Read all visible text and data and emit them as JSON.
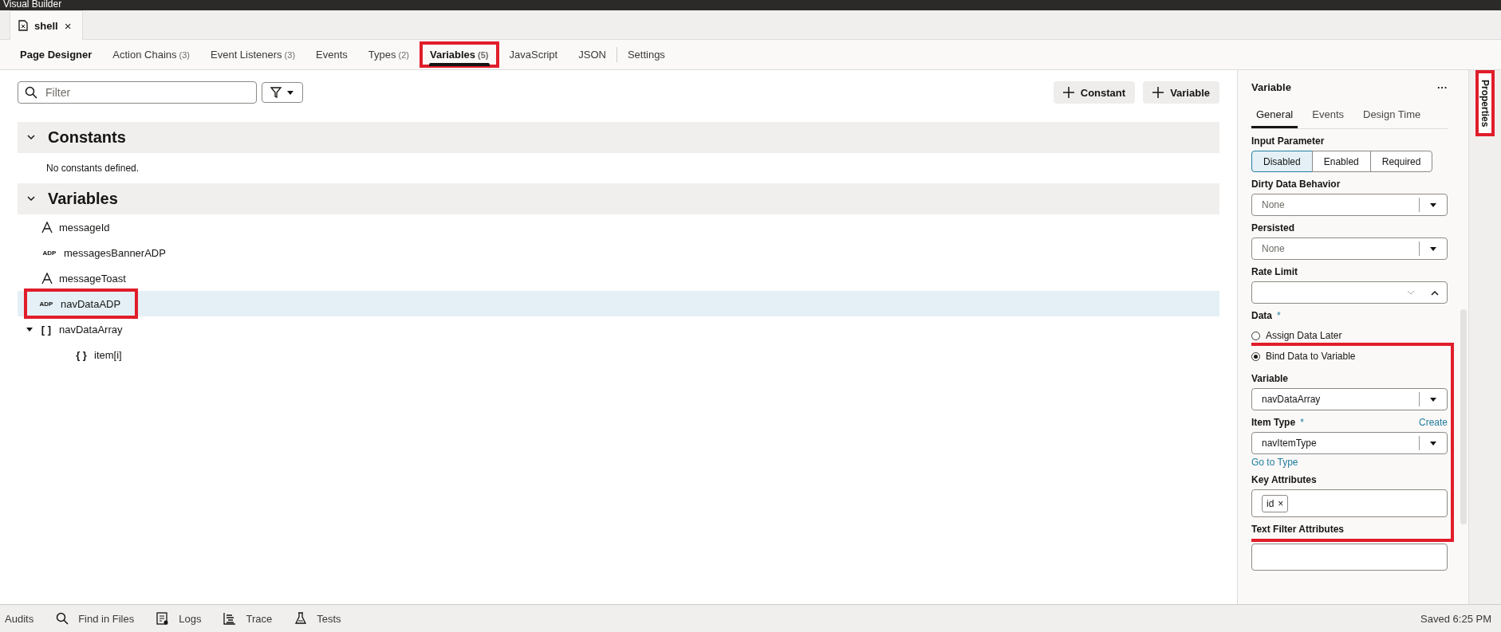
{
  "app_bar": {
    "title": "Visual Builder"
  },
  "file_tabs": [
    {
      "label": "shell",
      "selected": true,
      "close": "×"
    }
  ],
  "editor_tabs": [
    {
      "label": "Page Designer",
      "kind": "primary",
      "selected": false,
      "highlighted": false
    },
    {
      "label": "Action Chains",
      "count": "(3)",
      "kind": "tab",
      "selected": false,
      "highlighted": false
    },
    {
      "label": "Event Listeners",
      "count": "(3)",
      "kind": "tab",
      "selected": false,
      "highlighted": false
    },
    {
      "label": "Events",
      "kind": "tab",
      "selected": false,
      "highlighted": false
    },
    {
      "label": "Types",
      "count": "(2)",
      "kind": "tab",
      "selected": false,
      "highlighted": false
    },
    {
      "label": "Variables",
      "count": "(5)",
      "kind": "tab",
      "selected": true,
      "highlighted": true
    },
    {
      "label": "JavaScript",
      "kind": "tab",
      "selected": false,
      "highlighted": false
    },
    {
      "label": "JSON",
      "kind": "tab",
      "selected": false,
      "highlighted": false
    },
    {
      "label": "Settings",
      "kind": "tab",
      "selected": false,
      "highlighted": false,
      "separator_before": true
    }
  ],
  "toolbar": {
    "filter": {
      "placeholder": "Filter"
    },
    "buttons": [
      {
        "label": "Constant"
      },
      {
        "label": "Variable"
      }
    ]
  },
  "sections": [
    {
      "title": "Constants",
      "expanded": true,
      "empty_text": "No constants defined."
    },
    {
      "title": "Variables",
      "expanded": true,
      "items": [
        {
          "name": "messageId",
          "kind": "string",
          "selected": false,
          "highlighted": false
        },
        {
          "name": "messagesBannerADP",
          "kind": "adp",
          "icon_text": "ADP",
          "selected": false,
          "highlighted": false
        },
        {
          "name": "messageToast",
          "kind": "string",
          "selected": false,
          "highlighted": false
        },
        {
          "name": "navDataADP",
          "kind": "adp",
          "icon_text": "ADP",
          "selected": true,
          "highlighted": true
        },
        {
          "name": "navDataArray",
          "kind": "array",
          "icon_text": "[ ]",
          "selected": false,
          "highlighted": false,
          "expanded": true,
          "children": [
            {
              "name": "item[i]",
              "kind": "object",
              "icon_text": "{ }",
              "selected": false,
              "highlighted": false
            }
          ]
        }
      ]
    }
  ],
  "properties": {
    "title": "Variable",
    "more": "···",
    "tabs": [
      {
        "label": "General",
        "selected": true
      },
      {
        "label": "Events",
        "selected": false
      },
      {
        "label": "Design Time",
        "selected": false
      }
    ],
    "input_parameter": {
      "label": "Input Parameter",
      "options": [
        {
          "label": "Disabled",
          "selected": true
        },
        {
          "label": "Enabled",
          "selected": false
        },
        {
          "label": "Required",
          "selected": false
        }
      ]
    },
    "dirty_data_behavior": {
      "label": "Dirty Data Behavior",
      "placeholder": "None"
    },
    "persisted": {
      "label": "Persisted",
      "placeholder": "None"
    },
    "rate_limit": {
      "label": "Rate Limit",
      "expanded": true
    },
    "data": {
      "label": "Data",
      "required_mark": "*",
      "options": [
        {
          "label": "Assign Data Later",
          "selected": false
        },
        {
          "label": "Bind Data to Variable",
          "selected": true
        }
      ]
    },
    "binding": {
      "highlighted": true,
      "variable": {
        "label": "Variable",
        "value": "navDataArray"
      },
      "item_type": {
        "label": "Item Type",
        "required_mark": "*",
        "action": "Create",
        "value": "navItemType",
        "link": "Go to Type"
      },
      "key_attributes": {
        "label": "Key Attributes",
        "chips": [
          {
            "label": "id",
            "remove": "×"
          }
        ]
      },
      "text_filter_attributes": {
        "label": "Text Filter Attributes"
      }
    }
  },
  "side_tab": {
    "label": "Properties",
    "highlighted": true
  },
  "status_bar": {
    "items": [
      {
        "label": "Audits",
        "kind": "plain"
      },
      {
        "label": "Find in Files",
        "kind": "search"
      },
      {
        "label": "Logs",
        "kind": "log"
      },
      {
        "label": "Trace",
        "kind": "trace"
      },
      {
        "label": "Tests",
        "kind": "flask"
      }
    ],
    "saved": "Saved 6:25 PM"
  }
}
